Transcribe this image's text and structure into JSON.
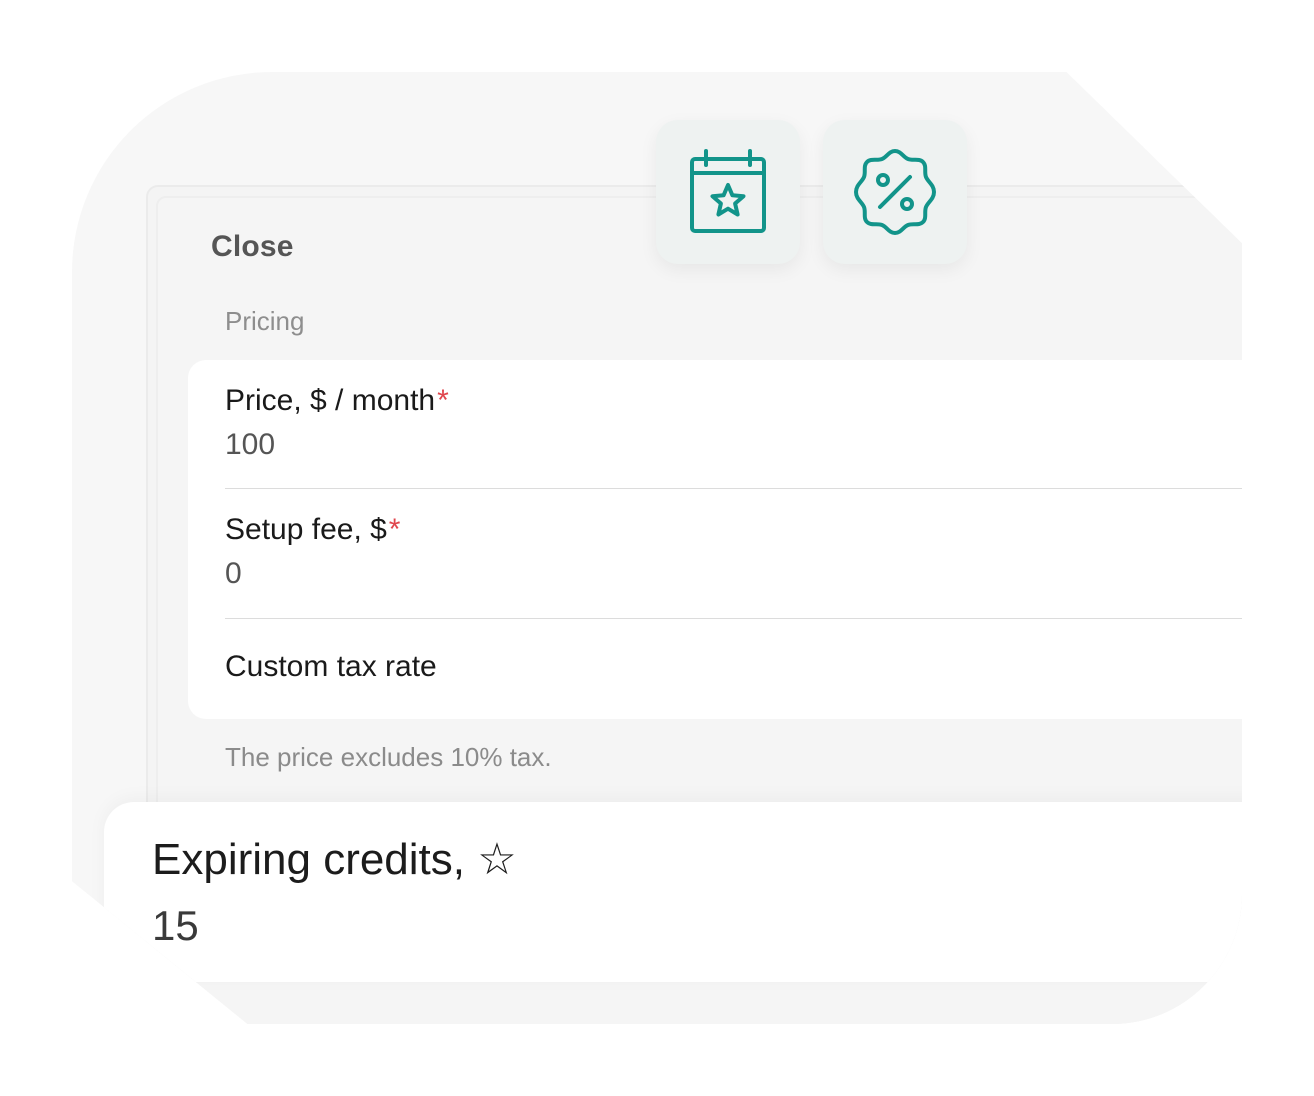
{
  "close_label": "Close",
  "section_label": "Pricing",
  "fields": [
    {
      "label": "Price, $ / month",
      "required_mark": "*",
      "value": "100"
    },
    {
      "label": "Setup fee, $",
      "required_mark": "*",
      "value": "0"
    },
    {
      "label": "Custom tax rate"
    }
  ],
  "helper_text": "The price excludes 10% tax.",
  "credits": {
    "label": "Expiring credits, ☆",
    "value": "15"
  },
  "icons": {
    "calendar": "calendar-star-icon",
    "discount": "discount-badge-icon"
  },
  "colors": {
    "accent": "#12948a",
    "required": "#e0464d"
  }
}
